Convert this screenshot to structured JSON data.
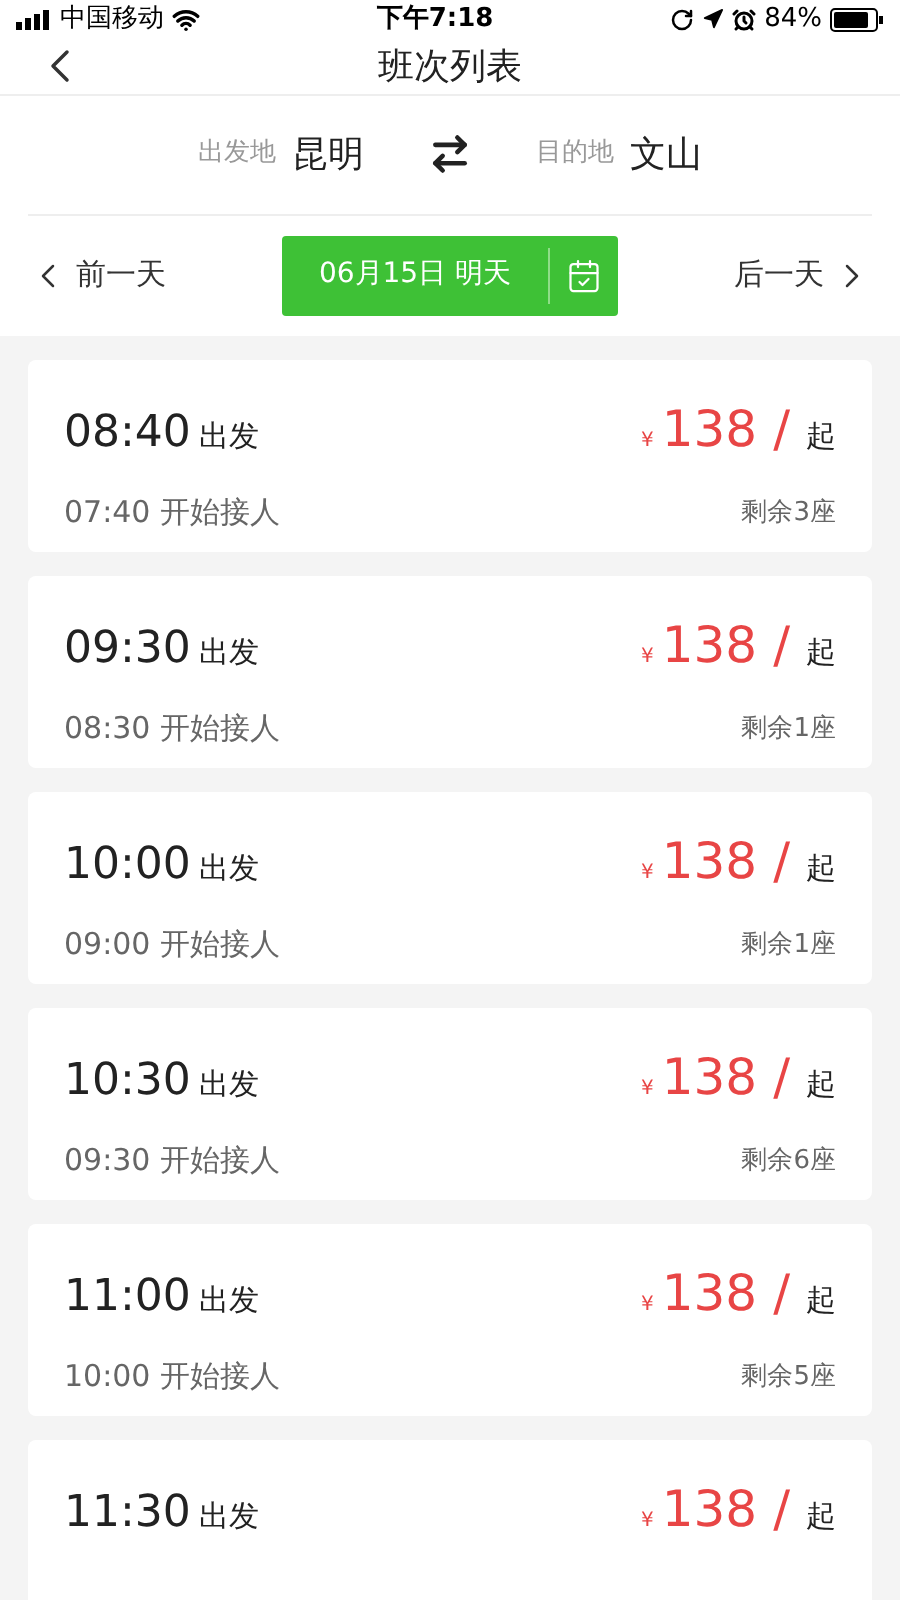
{
  "status_bar": {
    "carrier": "中国移动",
    "time": "下午7:18",
    "battery": "84%"
  },
  "nav": {
    "title": "班次列表"
  },
  "route": {
    "from_label": "出发地",
    "from": "昆明",
    "to_label": "目的地",
    "to": "文山"
  },
  "date_bar": {
    "prev": "前一天",
    "date": "06月15日 明天",
    "next": "后一天"
  },
  "trips": [
    {
      "depart_time": "08:40",
      "depart_label": "出发",
      "currency": "¥",
      "price": "138",
      "slash": "/",
      "price_suffix": "起",
      "pickup": "07:40 开始接人",
      "seats": "剩余3座"
    },
    {
      "depart_time": "09:30",
      "depart_label": "出发",
      "currency": "¥",
      "price": "138",
      "slash": "/",
      "price_suffix": "起",
      "pickup": "08:30 开始接人",
      "seats": "剩余1座"
    },
    {
      "depart_time": "10:00",
      "depart_label": "出发",
      "currency": "¥",
      "price": "138",
      "slash": "/",
      "price_suffix": "起",
      "pickup": "09:00 开始接人",
      "seats": "剩余1座"
    },
    {
      "depart_time": "10:30",
      "depart_label": "出发",
      "currency": "¥",
      "price": "138",
      "slash": "/",
      "price_suffix": "起",
      "pickup": "09:30 开始接人",
      "seats": "剩余6座"
    },
    {
      "depart_time": "11:00",
      "depart_label": "出发",
      "currency": "¥",
      "price": "138",
      "slash": "/",
      "price_suffix": "起",
      "pickup": "10:00 开始接人",
      "seats": "剩余5座"
    },
    {
      "depart_time": "11:30",
      "depart_label": "出发",
      "currency": "¥",
      "price": "138",
      "slash": "/",
      "price_suffix": "起"
    }
  ]
}
